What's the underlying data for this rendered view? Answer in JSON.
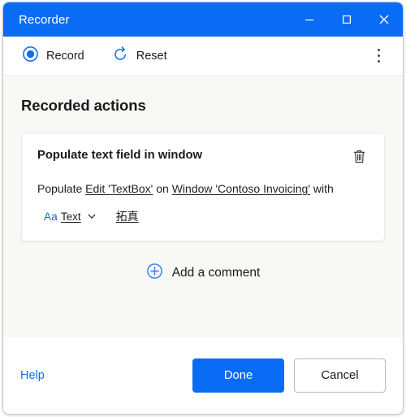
{
  "window": {
    "title": "Recorder",
    "controls": {
      "minimize": "minimize",
      "maximize": "maximize",
      "close": "close"
    }
  },
  "toolbar": {
    "record_label": "Record",
    "reset_label": "Reset",
    "more_options": "More options"
  },
  "main": {
    "section_heading": "Recorded actions",
    "action_card": {
      "title": "Populate text field in window",
      "delete_tooltip": "Delete",
      "description": {
        "prefix": "Populate",
        "target_link": "Edit 'TextBox'",
        "middle": "on",
        "window_link": "Window 'Contoso Invoicing'",
        "suffix": "with"
      },
      "value_row": {
        "type_icon": "Aa",
        "type_label": "Text",
        "value": "拓真"
      }
    },
    "add_comment_label": "Add a comment"
  },
  "footer": {
    "help_label": "Help",
    "done_label": "Done",
    "cancel_label": "Cancel"
  },
  "colors": {
    "accent": "#0a6cf5",
    "titlebar": "#0a6cf5",
    "body_bg": "#f8f8f7",
    "card_bg": "#ffffff",
    "text": "#1b1b1b"
  }
}
